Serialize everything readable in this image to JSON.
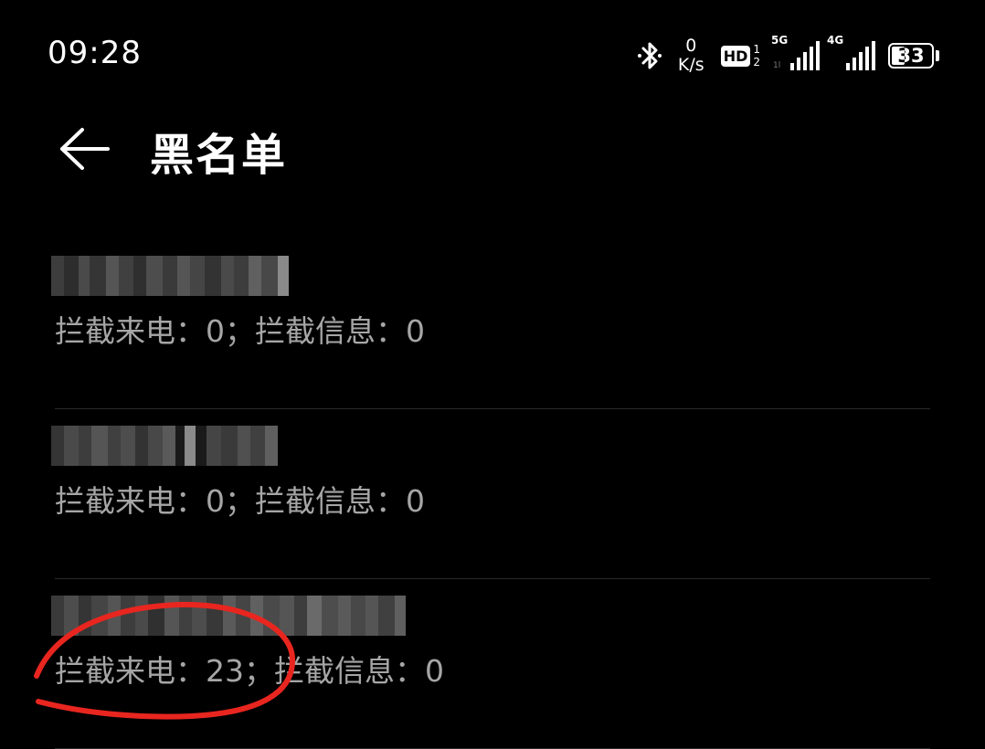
{
  "status_bar": {
    "time": "09:28",
    "net_speed_value": "0",
    "net_speed_unit": "K/s",
    "hd_label": "HD",
    "hd_sim1": "1",
    "hd_sim2": "2",
    "signal1_label": "5G",
    "signal1_sub": "1l",
    "signal2_label": "4G",
    "battery_level": "33"
  },
  "header": {
    "title": "黑名单"
  },
  "blacklist": [
    {
      "stats": "拦截来电：0；拦截信息：0"
    },
    {
      "stats": "拦截来电：0；拦截信息：0"
    },
    {
      "stats": "拦截来电：23；拦截信息：0"
    }
  ],
  "colors": {
    "background": "#000000",
    "text_primary": "#ffffff",
    "text_secondary": "#a6a6a6",
    "annotation": "#e8261f"
  }
}
